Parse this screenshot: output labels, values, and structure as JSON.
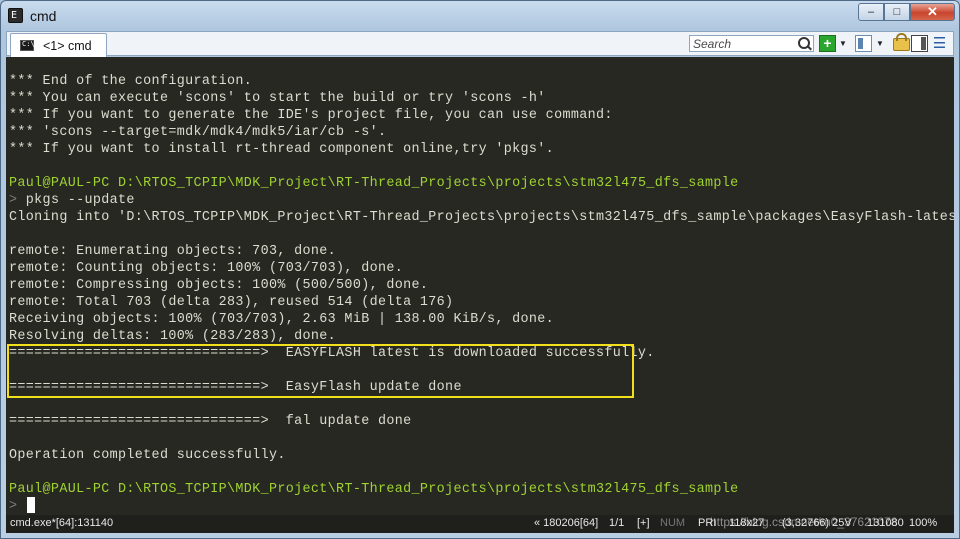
{
  "window": {
    "title": "cmd",
    "app_icon_glyph": "E",
    "controls": {
      "minimize": "–",
      "maximize": "□",
      "close": "✕"
    }
  },
  "toolbar": {
    "tab_label": "<1> cmd",
    "tab_icon_glyph": "C:\\",
    "search_placeholder": "Search",
    "add_glyph": "+",
    "dropdown_glyph": "▼",
    "menu_glyph": "☰"
  },
  "console": {
    "lines": [
      "*** End of the configuration.",
      "*** You can execute 'scons' to start the build or try 'scons -h'",
      "*** If you want to generate the IDE's project file, you can use command:",
      "*** 'scons --target=mdk/mdk4/mdk5/iar/cb -s'.",
      "*** If you want to install rt-thread component online,try 'pkgs'.",
      "",
      "Paul@PAUL-PC D:\\RTOS_TCPIP\\MDK_Project\\RT-Thread_Projects\\projects\\stm32l475_dfs_sample",
      "> pkgs --update",
      "Cloning into 'D:\\RTOS_TCPIP\\MDK_Project\\RT-Thread_Projects\\projects\\stm32l475_dfs_sample\\packages\\EasyFlash-latest'...",
      "",
      "remote: Enumerating objects: 703, done.",
      "remote: Counting objects: 100% (703/703), done.",
      "remote: Compressing objects: 100% (500/500), done.",
      "remote: Total 703 (delta 283), reused 514 (delta 176)",
      "Receiving objects: 100% (703/703), 2.63 MiB | 138.00 KiB/s, done.",
      "Resolving deltas: 100% (283/283), done.",
      "==============================>  EASYFLASH latest is downloaded successfully.",
      "",
      "==============================>  EasyFlash update done",
      "",
      "==============================>  fal update done",
      "",
      "Operation completed successfully.",
      "",
      "",
      "Paul@PAUL-PC D:\\RTOS_TCPIP\\MDK_Project\\RT-Thread_Projects\\projects\\stm32l475_dfs_sample",
      ">"
    ],
    "prompt_user": "Paul@PAUL-PC",
    "prompt_path": " D:\\RTOS_TCPIP\\MDK_Project\\RT-Thread_Projects\\projects\\stm32l475_dfs_sample",
    "prompt_arrow": "> ",
    "command": "pkgs --update",
    "final_arrow": ">"
  },
  "statusbar": {
    "process": "cmd.exe*[64]:131140",
    "position": "« 180206[64]",
    "page": "1/1",
    "plus": "[+]",
    "num": "NUM",
    "pri": "PRI",
    "size": "118x27",
    "coords": "(3,32766) 25V",
    "pid": "131080",
    "zoom": "100%",
    "watermark": "https://blog.csdn.net/m0_37621078"
  },
  "colors": {
    "console_bg": "#272822",
    "console_text": "#dcdcd0",
    "prompt_green": "#9fd331",
    "highlight_box": "#f2e01c"
  }
}
